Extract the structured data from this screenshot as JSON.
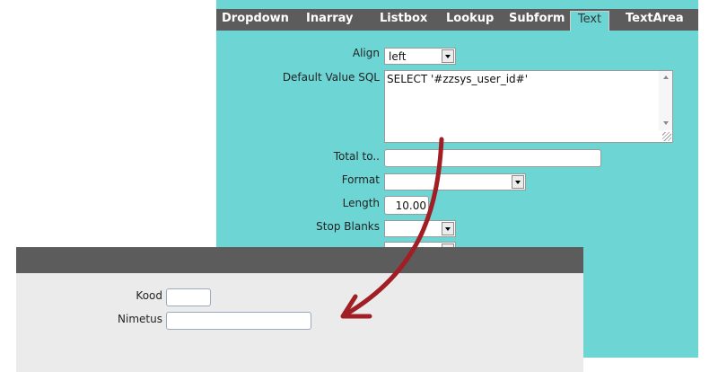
{
  "tabs": [
    "Dropdown",
    "Inarray",
    "Listbox",
    "Lookup",
    "Subform",
    "Text",
    "TextArea"
  ],
  "active_tab": "Text",
  "fields": {
    "align": {
      "label": "Align",
      "value": "left"
    },
    "default_sql": {
      "label": "Default Value SQL",
      "value": "SELECT '#zzsys_user_id#'"
    },
    "total_to": {
      "label": "Total to..",
      "value": ""
    },
    "format": {
      "label": "Format",
      "value": ""
    },
    "length": {
      "label": "Length",
      "value": "10.00"
    },
    "stop_blanks": {
      "label": "Stop Blanks",
      "value": ""
    }
  },
  "bottom_form": {
    "kood_label": "Kood",
    "nimetus_label": "Nimetus",
    "kood_value": "",
    "nimetus_value": ""
  },
  "colors": {
    "panel": "#6dd6d4",
    "tabbar": "#5c5c5c",
    "bottom_panel": "#ebebeb",
    "arrow": "#a01e24"
  }
}
